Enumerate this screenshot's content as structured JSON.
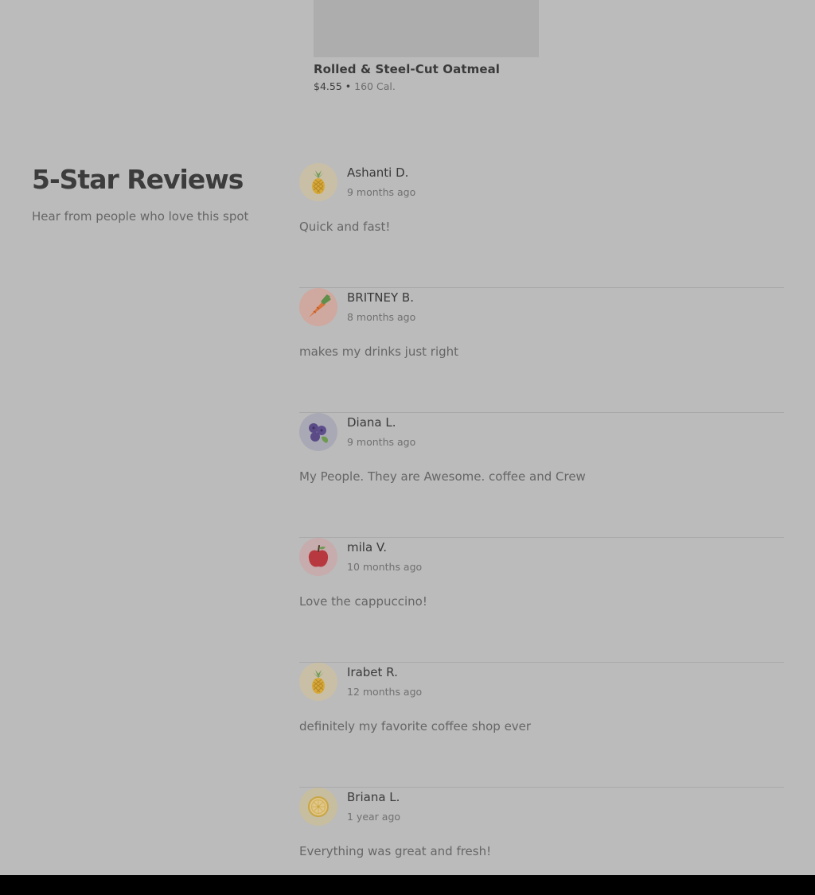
{
  "product": {
    "name": "Rolled & Steel-Cut Oatmeal",
    "price": "$4.55",
    "separator": "•",
    "calories": "160 Cal."
  },
  "reviews_section": {
    "title": "5-Star Reviews",
    "subtitle": "Hear from people who love this spot"
  },
  "reviews": [
    {
      "name": "Ashanti D.",
      "date": "9 months ago",
      "text": "Quick and fast!",
      "avatar_icon": "pineapple-icon",
      "avatar_bg": "#c9bfa7"
    },
    {
      "name": "BRITNEY B.",
      "date": "8 months ago",
      "text": "makes my drinks just right",
      "avatar_icon": "carrot-icon",
      "avatar_bg": "#cfa89f"
    },
    {
      "name": "Diana L.",
      "date": "9 months ago",
      "text": "My People. They are Awesome. coffee and Crew",
      "avatar_icon": "blueberry-icon",
      "avatar_bg": "#a9a9b5"
    },
    {
      "name": "mila V.",
      "date": "10 months ago",
      "text": "Love the cappuccino!",
      "avatar_icon": "apple-icon",
      "avatar_bg": "#c6acac"
    },
    {
      "name": "Irabet R.",
      "date": "12 months ago",
      "text": "definitely my favorite coffee shop ever",
      "avatar_icon": "pineapple-icon",
      "avatar_bg": "#c9bfa7"
    },
    {
      "name": "Briana L.",
      "date": "1 year ago",
      "text": "Everything was great and fresh!",
      "avatar_icon": "lemon-icon",
      "avatar_bg": "#c7bd9f"
    }
  ]
}
